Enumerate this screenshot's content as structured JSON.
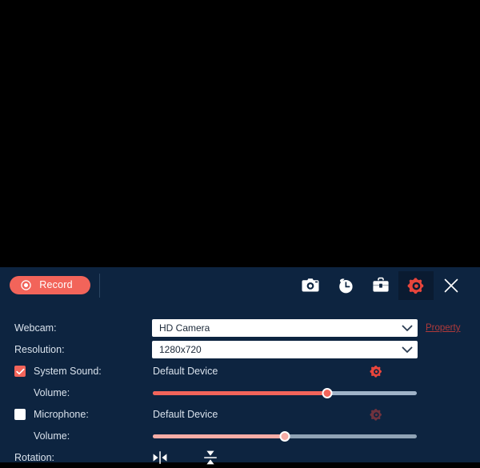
{
  "window": {
    "preview_area_name": "recording-preview",
    "panel_background": "#0d2440",
    "accent_color": "#f2645a"
  },
  "toolbar": {
    "record_label": "Record",
    "record_icon": "record-dot-icon",
    "buttons": [
      {
        "name": "screenshot-button",
        "icon": "camera-icon",
        "active": false
      },
      {
        "name": "schedule-button",
        "icon": "clock-icon",
        "active": false
      },
      {
        "name": "toolbox-button",
        "icon": "toolbox-icon",
        "active": false
      },
      {
        "name": "settings-button",
        "icon": "gear-icon",
        "active": true
      },
      {
        "name": "close-button",
        "icon": "close-icon",
        "active": false
      }
    ]
  },
  "settings": {
    "webcam": {
      "label": "Webcam:",
      "value": "HD Camera",
      "property_link": "Property"
    },
    "resolution": {
      "label": "Resolution:",
      "value": "1280x720"
    },
    "system_sound": {
      "label": "System Sound:",
      "checked": true,
      "device": "Default Device",
      "volume_label": "Volume:",
      "volume_percent": 66
    },
    "microphone": {
      "label": "Microphone:",
      "checked": false,
      "device": "Default Device",
      "volume_label": "Volume:",
      "volume_percent": 50
    },
    "rotation": {
      "label": "Rotation:",
      "flip_horizontal_icon": "flip-horizontal-icon",
      "flip_vertical_icon": "flip-vertical-icon"
    }
  }
}
